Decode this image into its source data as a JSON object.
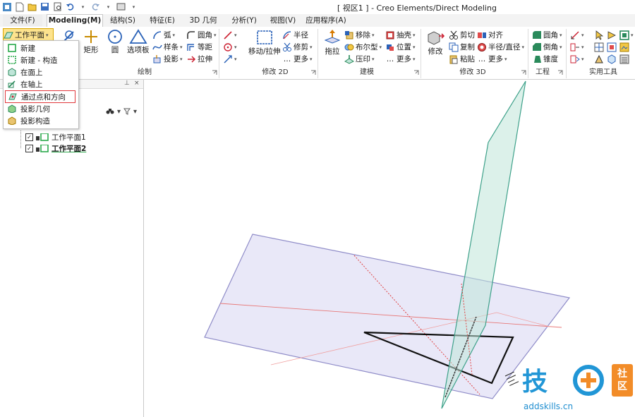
{
  "window": {
    "title": "[ 视区1 ] - Creo Elements/Direct Modeling"
  },
  "tabs": [
    {
      "label": "文件(F)"
    },
    {
      "label": "Modeling(M)"
    },
    {
      "label": "结构(S)"
    },
    {
      "label": "特征(E)"
    },
    {
      "label": "3D 几何"
    },
    {
      "label": "分析(Y)"
    },
    {
      "label": "视图(V)"
    },
    {
      "label": "应用程序(A)"
    }
  ],
  "ribbon": {
    "workplane_button": "工作平面",
    "draw": {
      "rectangle": "矩形",
      "circle": "圆",
      "palette": "选项板",
      "arc": "弧",
      "spline": "样条",
      "project": "投影",
      "fillet": "圆角",
      "equidistant": "等距",
      "stretch": "拉伸",
      "label": "绘制"
    },
    "modify2d": {
      "move_stretch": "移动/拉伸",
      "radius": "半径",
      "trim": "修剪",
      "more": "更多",
      "label": "修改 2D"
    },
    "modeling": {
      "pull": "拖拉",
      "move": "移除",
      "boolean": "布尔型",
      "imprint": "压印",
      "shell": "抽壳",
      "position": "位置",
      "more": "更多",
      "label": "建模"
    },
    "modify3d": {
      "modify": "修改",
      "cut": "剪切",
      "copy": "复制",
      "paste": "粘贴",
      "align": "对齐",
      "radius_diameter": "半径/直径",
      "more": "更多",
      "label": "修改 3D"
    },
    "engineering": {
      "fillet": "圆角",
      "chamfer": "倒角",
      "taper": "锥度",
      "label": "工程"
    },
    "utilities": {
      "label": "实用工具"
    }
  },
  "workplane_menu": [
    {
      "label": "新建"
    },
    {
      "label": "新建 - 构造"
    },
    {
      "label": "在面上"
    },
    {
      "label": "在轴上"
    },
    {
      "label": "通过点和方向"
    },
    {
      "label": "投影几何"
    },
    {
      "label": "投影构造"
    }
  ],
  "tree": [
    {
      "label": "工作平面1",
      "checked": true
    },
    {
      "label": "工作平面2",
      "checked": true
    }
  ],
  "watermark": {
    "main": "技",
    "side_top": "社",
    "side_bottom": "区",
    "url": "addskills.cn"
  },
  "colors": {
    "accent": "#fde38d",
    "highlight_border": "#e0383c",
    "plane_fill": "#e9e8f8",
    "plane2_fill": "#bfe5d8"
  }
}
